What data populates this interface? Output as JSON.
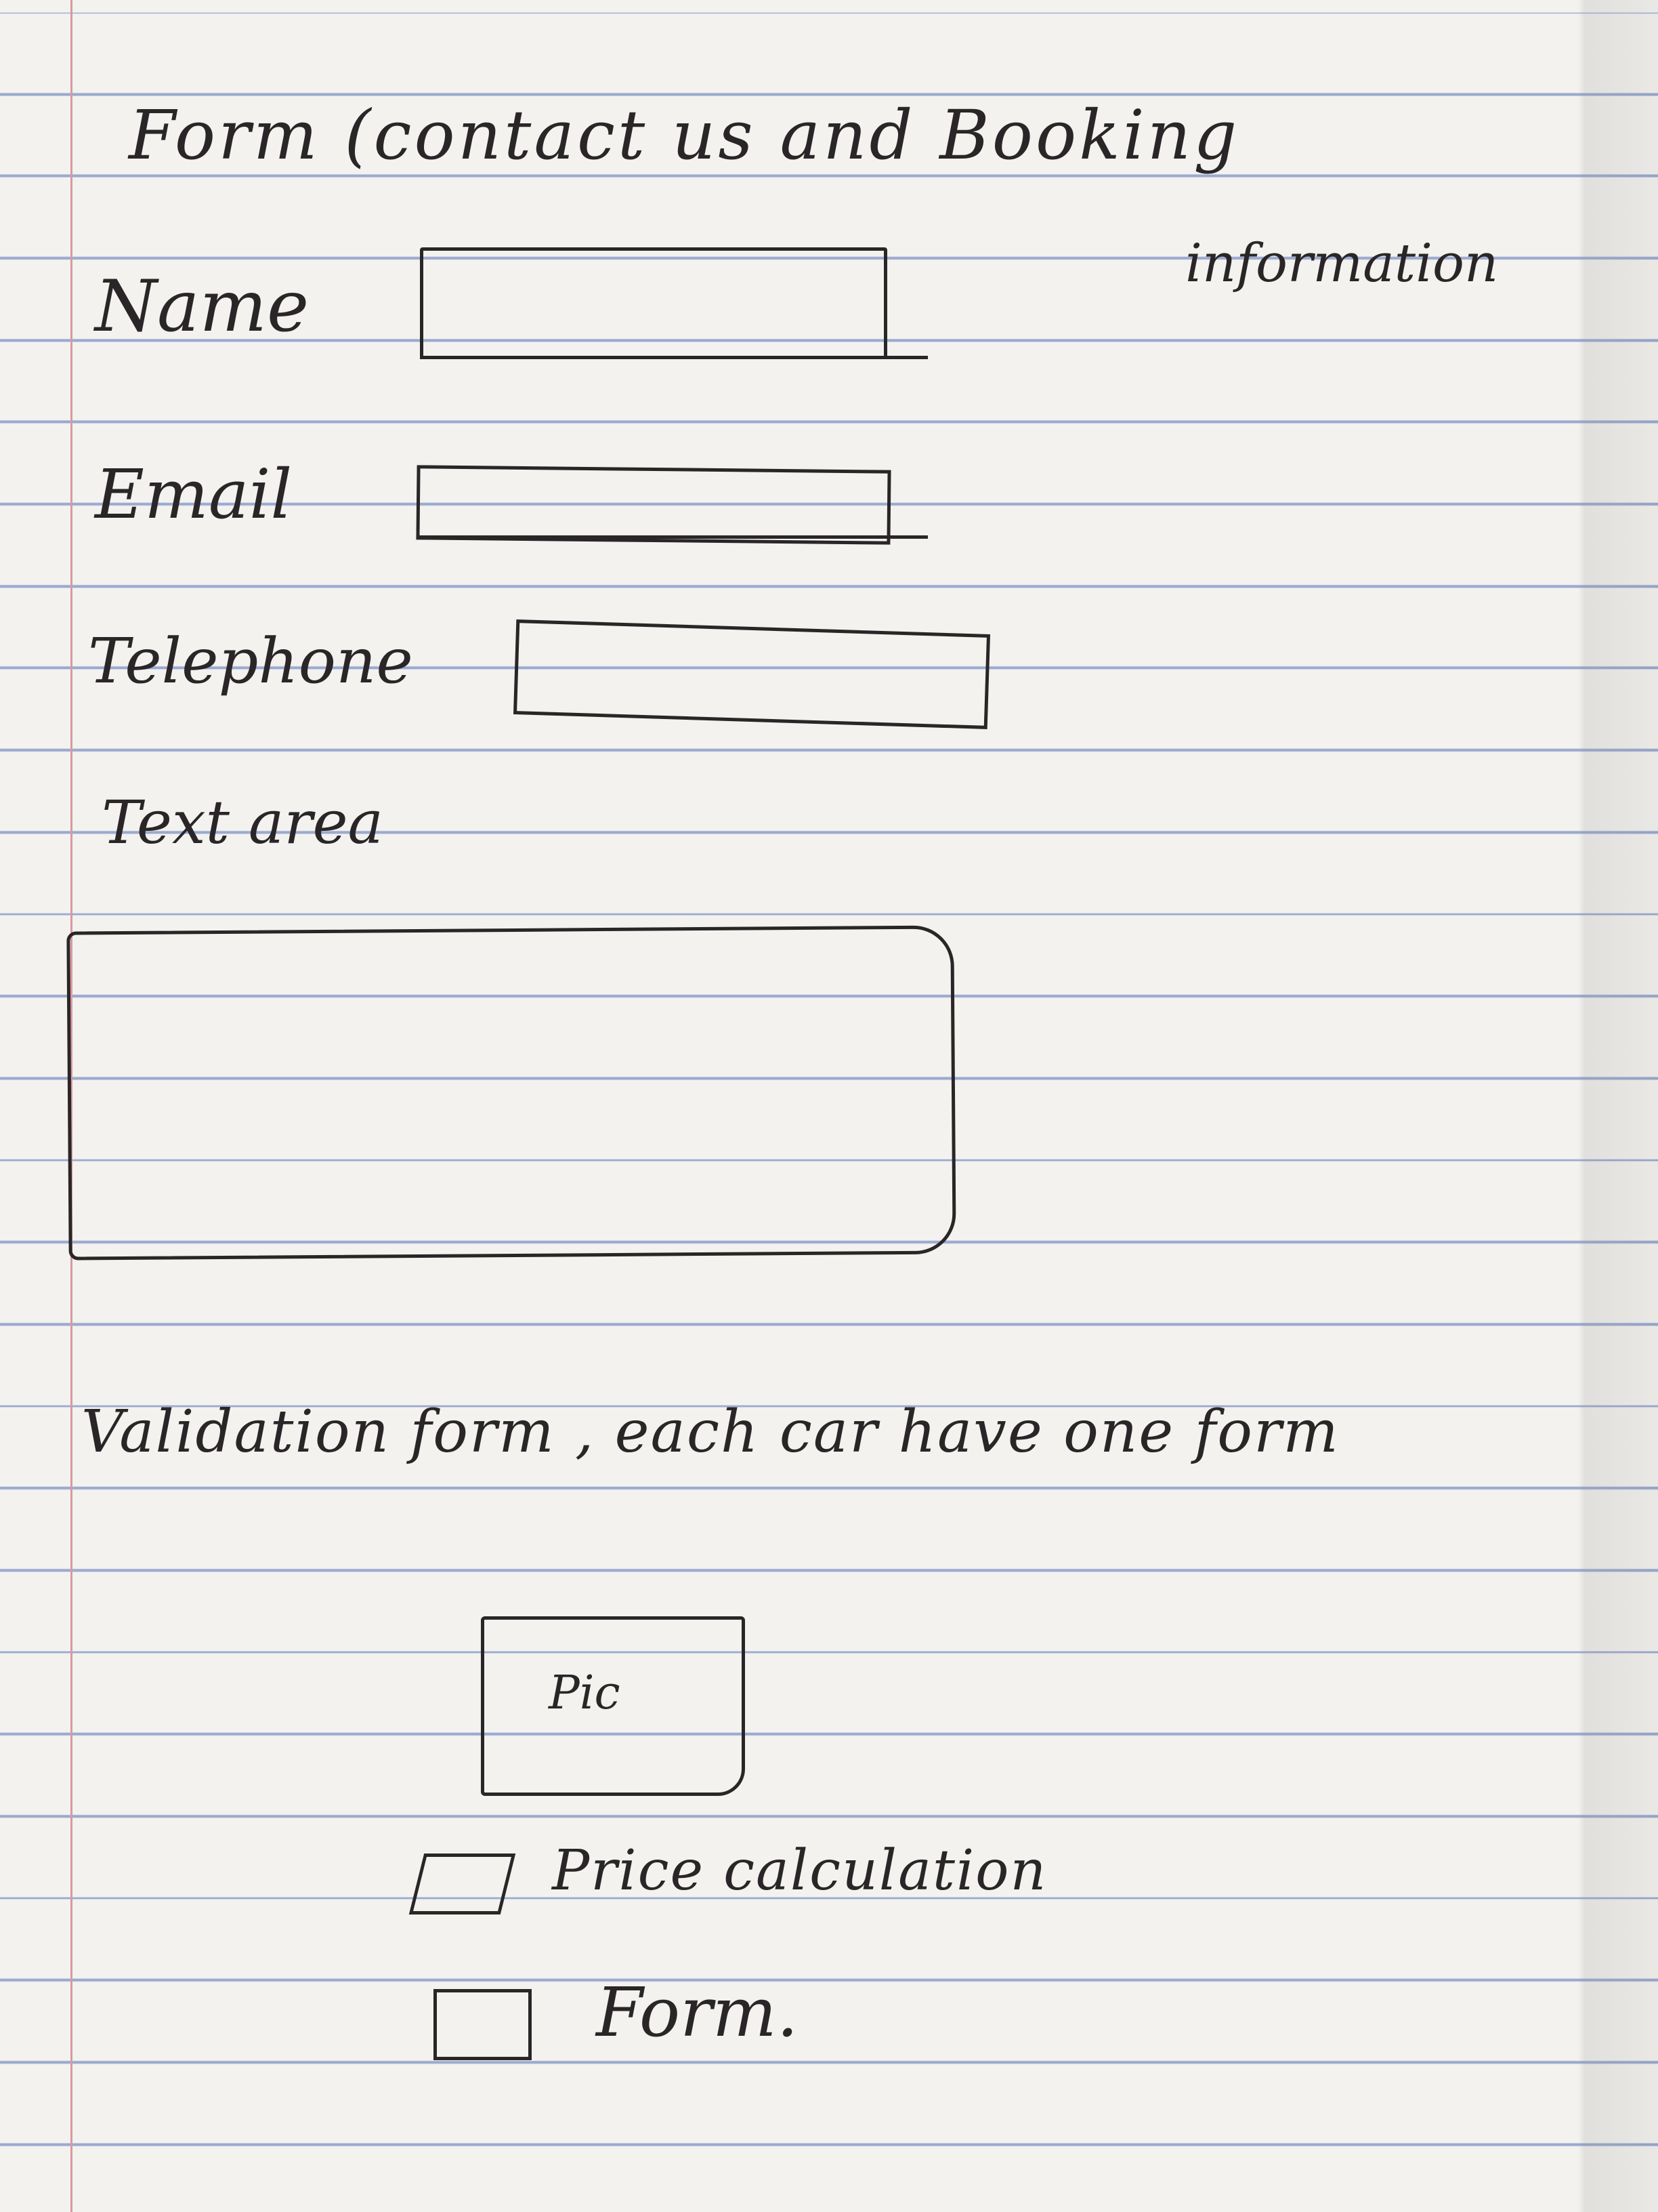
{
  "heading": {
    "line1": "Form (contact us and Booking",
    "line2": "information"
  },
  "fields": {
    "name_label": "Name",
    "email_label": "Email",
    "telephone_label": "Telephone",
    "textarea_label": "Text area"
  },
  "validation_note": "Validation form , each car have one form",
  "pic_label": "Pic",
  "checkboxes": [
    {
      "label": "Price calculation",
      "checked": false
    },
    {
      "label": "Form.",
      "checked": false
    }
  ]
}
